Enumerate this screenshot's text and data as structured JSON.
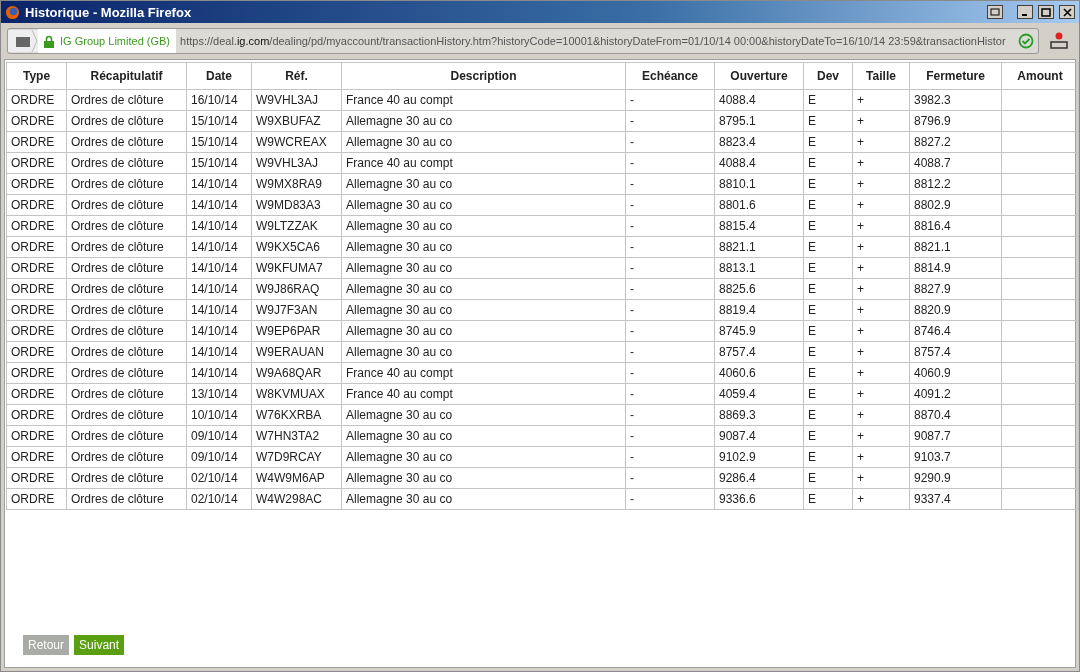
{
  "window": {
    "title": "Historique - Mozilla Firefox"
  },
  "address_bar": {
    "identity": "IG Group Limited (GB)",
    "url_prefix": "https://deal.",
    "url_domain": "ig.com",
    "url_rest": "/dealing/pd/myaccount/transactionHistory.htm?historyCode=10001&historyDateFrom=01/10/14 00:00&historyDateTo=16/10/14 23:59&transactionHistor"
  },
  "table": {
    "columns": [
      "Type",
      "Récapitulatif",
      "Date",
      "Réf.",
      "Description",
      "Echéance",
      "Ouverture",
      "Dev",
      "Taille",
      "Fermeture",
      "Amount"
    ],
    "rows": [
      [
        "ORDRE",
        "Ordres de clôture",
        "16/10/14",
        "W9VHL3AJ",
        "France 40 au compt",
        "-",
        "4088.4",
        "E",
        "+",
        "3982.3",
        ""
      ],
      [
        "ORDRE",
        "Ordres de clôture",
        "15/10/14",
        "W9XBUFAZ",
        "Allemagne 30 au co",
        "-",
        "8795.1",
        "E",
        "+",
        "8796.9",
        ""
      ],
      [
        "ORDRE",
        "Ordres de clôture",
        "15/10/14",
        "W9WCREAX",
        "Allemagne 30 au co",
        "-",
        "8823.4",
        "E",
        "+",
        "8827.2",
        ""
      ],
      [
        "ORDRE",
        "Ordres de clôture",
        "15/10/14",
        "W9VHL3AJ",
        "France 40 au compt",
        "-",
        "4088.4",
        "E",
        "+",
        "4088.7",
        ""
      ],
      [
        "ORDRE",
        "Ordres de clôture",
        "14/10/14",
        "W9MX8RA9",
        "Allemagne 30 au co",
        "-",
        "8810.1",
        "E",
        "+",
        "8812.2",
        ""
      ],
      [
        "ORDRE",
        "Ordres de clôture",
        "14/10/14",
        "W9MD83A3",
        "Allemagne 30 au co",
        "-",
        "8801.6",
        "E",
        "+",
        "8802.9",
        ""
      ],
      [
        "ORDRE",
        "Ordres de clôture",
        "14/10/14",
        "W9LTZZAK",
        "Allemagne 30 au co",
        "-",
        "8815.4",
        "E",
        "+",
        "8816.4",
        ""
      ],
      [
        "ORDRE",
        "Ordres de clôture",
        "14/10/14",
        "W9KX5CA6",
        "Allemagne 30 au co",
        "-",
        "8821.1",
        "E",
        "+",
        "8821.1",
        ""
      ],
      [
        "ORDRE",
        "Ordres de clôture",
        "14/10/14",
        "W9KFUMA7",
        "Allemagne 30 au co",
        "-",
        "8813.1",
        "E",
        "+",
        "8814.9",
        ""
      ],
      [
        "ORDRE",
        "Ordres de clôture",
        "14/10/14",
        "W9J86RAQ",
        "Allemagne 30 au co",
        "-",
        "8825.6",
        "E",
        "+",
        "8827.9",
        ""
      ],
      [
        "ORDRE",
        "Ordres de clôture",
        "14/10/14",
        "W9J7F3AN",
        "Allemagne 30 au co",
        "-",
        "8819.4",
        "E",
        "+",
        "8820.9",
        ""
      ],
      [
        "ORDRE",
        "Ordres de clôture",
        "14/10/14",
        "W9EP6PAR",
        "Allemagne 30 au co",
        "-",
        "8745.9",
        "E",
        "+",
        "8746.4",
        ""
      ],
      [
        "ORDRE",
        "Ordres de clôture",
        "14/10/14",
        "W9ERAUAN",
        "Allemagne 30 au co",
        "-",
        "8757.4",
        "E",
        "+",
        "8757.4",
        ""
      ],
      [
        "ORDRE",
        "Ordres de clôture",
        "14/10/14",
        "W9A68QAR",
        "France 40 au compt",
        "-",
        "4060.6",
        "E",
        "+",
        "4060.9",
        ""
      ],
      [
        "ORDRE",
        "Ordres de clôture",
        "13/10/14",
        "W8KVMUAX",
        "France 40 au compt",
        "-",
        "4059.4",
        "E",
        "+",
        "4091.2",
        ""
      ],
      [
        "ORDRE",
        "Ordres de clôture",
        "10/10/14",
        "W76KXRBA",
        "Allemagne 30 au co",
        "-",
        "8869.3",
        "E",
        "+",
        "8870.4",
        ""
      ],
      [
        "ORDRE",
        "Ordres de clôture",
        "09/10/14",
        "W7HN3TA2",
        "Allemagne 30 au co",
        "-",
        "9087.4",
        "E",
        "+",
        "9087.7",
        ""
      ],
      [
        "ORDRE",
        "Ordres de clôture",
        "09/10/14",
        "W7D9RCAY",
        "Allemagne 30 au co",
        "-",
        "9102.9",
        "E",
        "+",
        "9103.7",
        ""
      ],
      [
        "ORDRE",
        "Ordres de clôture",
        "02/10/14",
        "W4W9M6AP",
        "Allemagne 30 au co",
        "-",
        "9286.4",
        "E",
        "+",
        "9290.9",
        ""
      ],
      [
        "ORDRE",
        "Ordres de clôture",
        "02/10/14",
        "W4W298AC",
        "Allemagne 30 au co",
        "-",
        "9336.6",
        "E",
        "+",
        "9337.4",
        ""
      ]
    ]
  },
  "pager": [
    {
      "label": "Retour",
      "disabled": true
    },
    {
      "label": "Suivant",
      "disabled": false
    }
  ]
}
